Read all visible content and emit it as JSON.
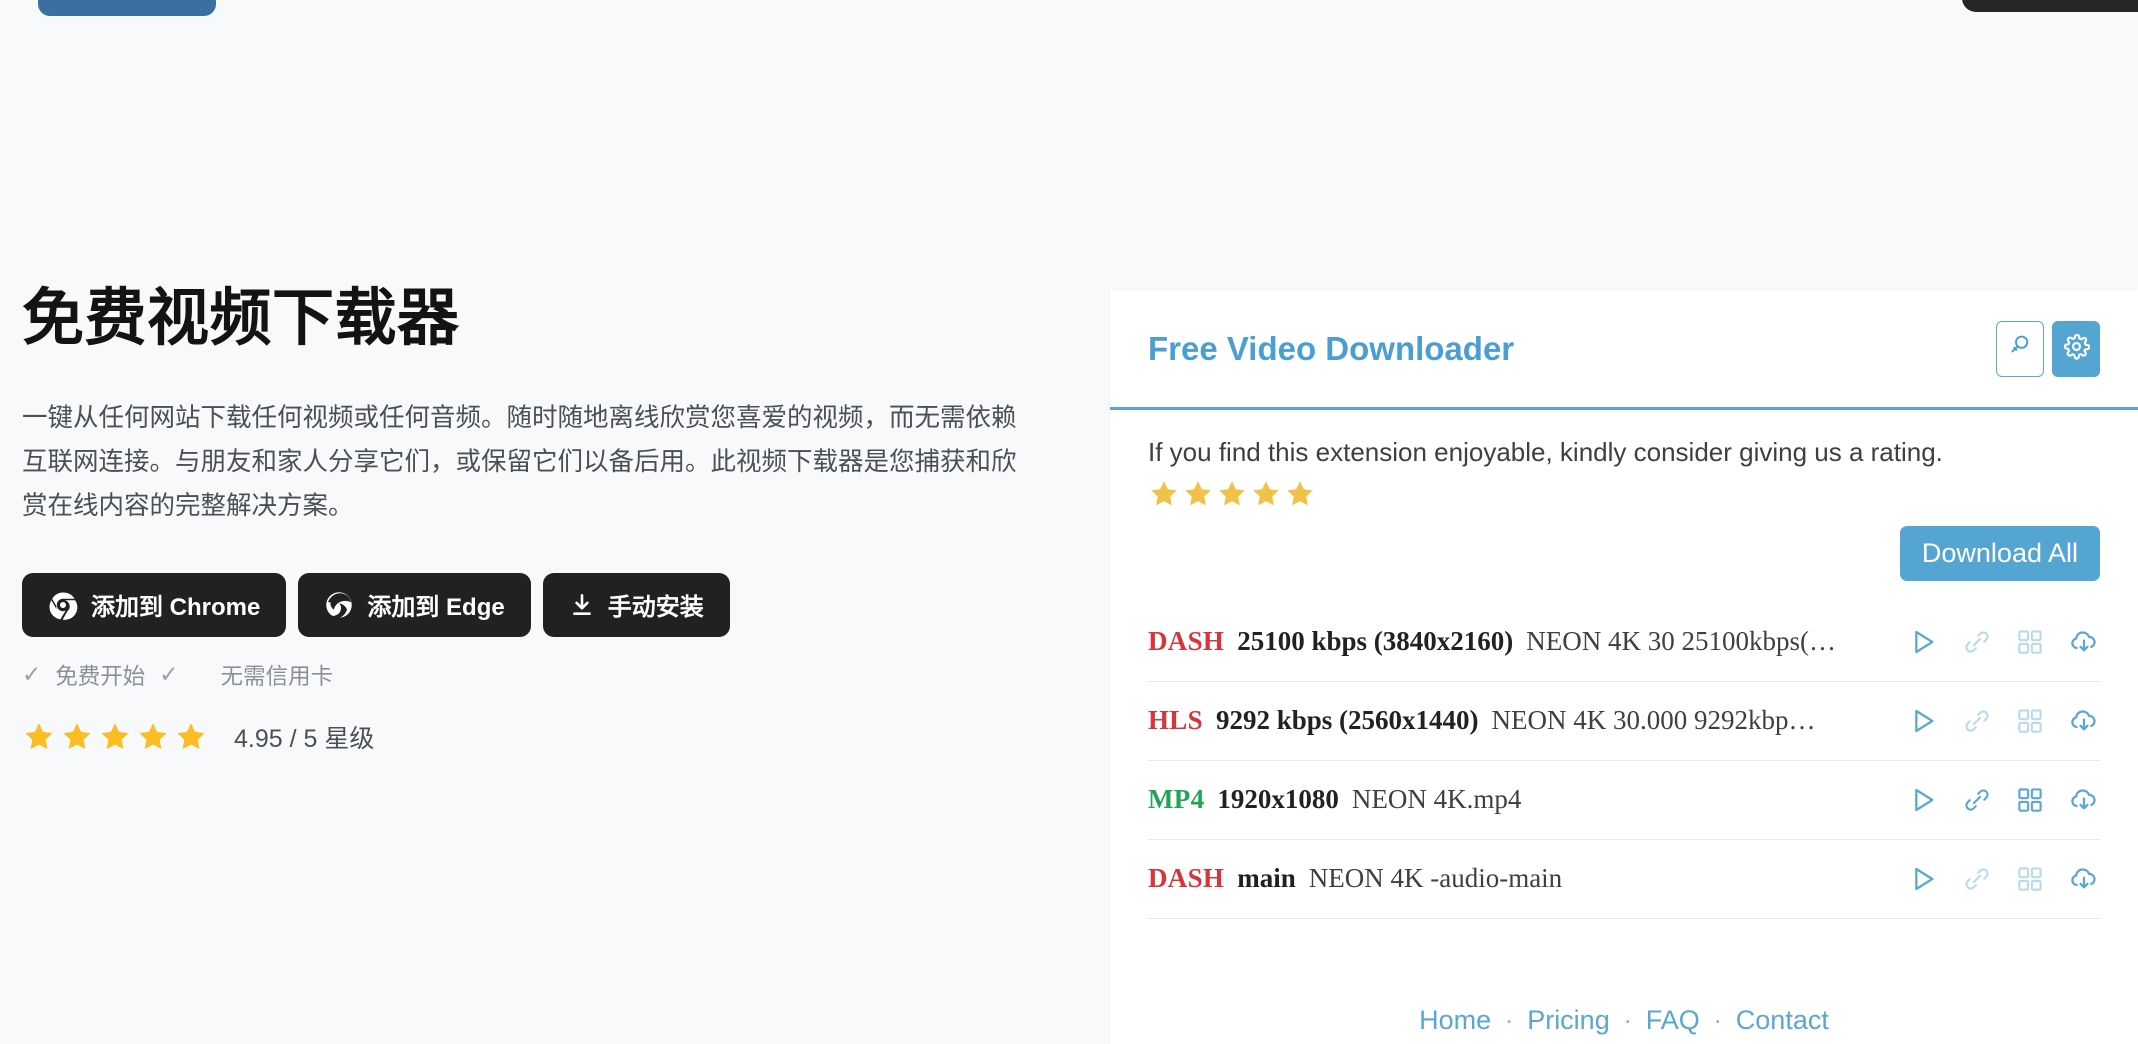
{
  "hero": {
    "title": "免费视频下载器",
    "description": "一键从任何网站下载任何视频或任何音频。随时随地离线欣赏您喜爱的视频，而无需依赖互联网连接。与朋友和家人分享它们，或保留它们以备后用。此视频下载器是您捕获和欣赏在线内容的完整解决方案。",
    "cta": [
      {
        "label": "添加到 Chrome",
        "icon": "chrome-icon"
      },
      {
        "label": "添加到 Edge",
        "icon": "edge-icon"
      },
      {
        "label": "手动安装",
        "icon": "download-icon"
      }
    ],
    "assurances": [
      {
        "check": "✓",
        "label": "免费开始"
      },
      {
        "check": "✓",
        "label": "无需信用卡"
      }
    ],
    "rating": {
      "stars": 5,
      "text": "4.95 / 5 星级",
      "star_color": "#FBBD23"
    }
  },
  "panel": {
    "brand": "Free Video Downloader",
    "actions": [
      {
        "name": "search-icon",
        "label": ""
      },
      {
        "name": "gear-icon",
        "label": ""
      }
    ],
    "promo_text": "If you find this extension enjoyable, kindly consider giving us a rating.",
    "promo_stars": 5,
    "promo_star_color": "#F2C14A",
    "download_all_label": "Download All",
    "accent_color": "#55A5D3",
    "rows": [
      {
        "tag": "DASH",
        "tag_type": "dash",
        "quality": "25100 kbps (3840x2160)",
        "filename": "NEON 4K   30  25100kbps(…",
        "actions": [
          "play-icon",
          "link-icon",
          "grid-icon",
          "cloud-download-icon"
        ],
        "link_enabled": false,
        "grid_enabled": false
      },
      {
        "tag": "HLS",
        "tag_type": "hls",
        "quality": "9292 kbps (2560x1440)",
        "filename": "NEON 4K  30.000  9292kbp…",
        "actions": [
          "play-icon",
          "link-icon",
          "grid-icon",
          "cloud-download-icon"
        ],
        "link_enabled": false,
        "grid_enabled": false
      },
      {
        "tag": "MP4",
        "tag_type": "mp4",
        "quality": "1920x1080",
        "filename": "NEON 4K.mp4",
        "actions": [
          "play-icon",
          "link-icon",
          "grid-icon",
          "cloud-download-icon"
        ],
        "link_enabled": true,
        "grid_enabled": true
      },
      {
        "tag": "DASH",
        "tag_type": "dash",
        "quality": "main",
        "filename": "NEON 4K -audio-main",
        "actions": [
          "play-icon",
          "link-icon",
          "grid-icon",
          "cloud-download-icon"
        ],
        "link_enabled": false,
        "grid_enabled": false
      }
    ],
    "footer": {
      "links": [
        "Home",
        "Pricing",
        "FAQ",
        "Contact"
      ],
      "separator": "·"
    }
  }
}
